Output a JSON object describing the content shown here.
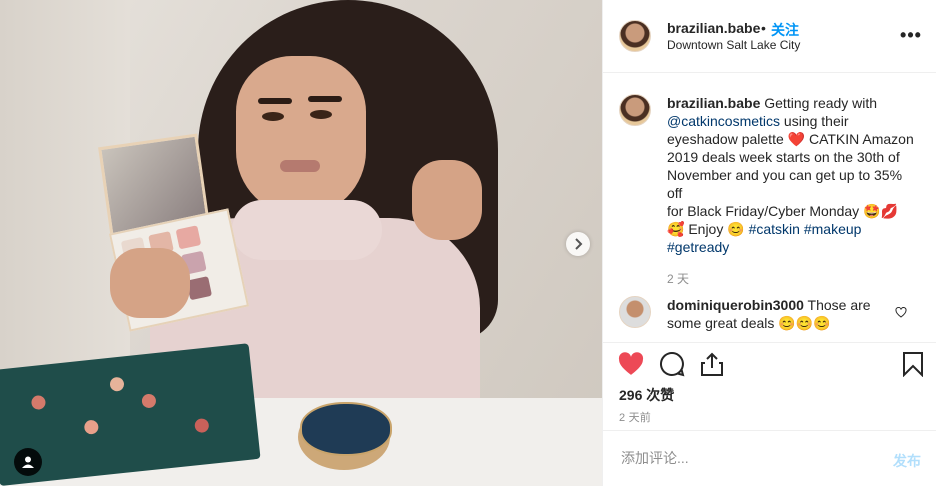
{
  "header": {
    "username": "brazilian.babe",
    "dot": "•",
    "follow_label": "关注",
    "location": "Downtown Salt Lake City",
    "more_label": "•••"
  },
  "caption": {
    "username": "brazilian.babe",
    "text1": " Getting ready with ",
    "mention": "@catkincosmetics",
    "text2": " using their eyeshadow palette ",
    "heart_emoji": "❤️",
    "text3": " CATKIN Amazon 2019 deals week starts on the 30th of November and you can get up to 35% off",
    "text4": "for Black Friday/Cyber Monday ",
    "emoji1": "🤩💋",
    "emoji2": "🥰",
    "text5": " Enjoy ",
    "emoji3": "😊",
    "hashtag1": "#catskin",
    "hashtag2": "#makeup",
    "hashtag3": "#getready",
    "time": "2 天"
  },
  "comment": {
    "username": "dominiquerobin3000",
    "text": " Those are some great deals ",
    "emojis": "😊😊😊"
  },
  "actions": {
    "likes": "296 次赞",
    "ago": "2 天前"
  },
  "add_comment": {
    "placeholder": "添加评论...",
    "post_label": "发布"
  },
  "colors": {
    "link": "#0095f6",
    "heart": "#ed4956",
    "tag": "#00376b"
  }
}
